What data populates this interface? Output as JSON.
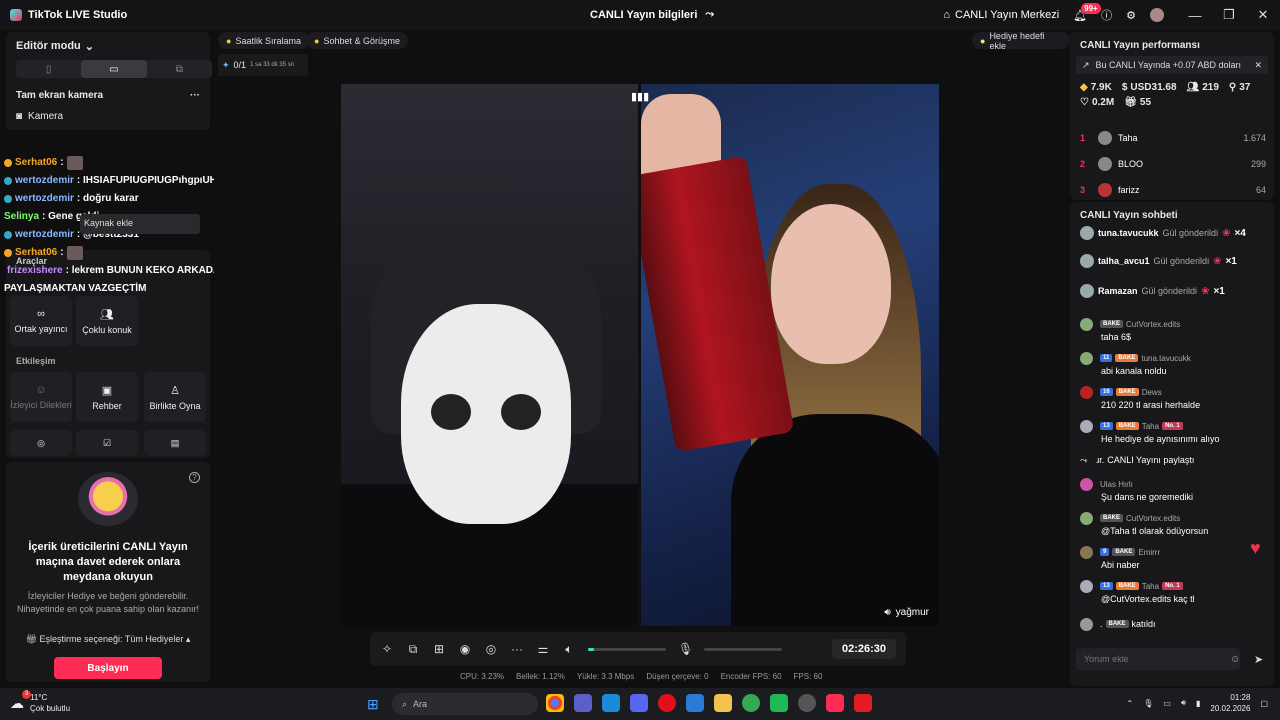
{
  "app": {
    "title": "TikTok LIVE Studio",
    "center_title": "CANLI Yayın bilgileri",
    "center_icon": "share-icon"
  },
  "header": {
    "live_center": "CANLI Yayın Merkezi",
    "notif_badge": "99+"
  },
  "left": {
    "editor_mode": "Editör modu",
    "source_title": "Tam ekran kamera",
    "camera_label": "Kamera",
    "tooltip": "Kaynak ekle",
    "tools_label": "Araçlar",
    "tools": [
      {
        "label": "Ortak yayıncı",
        "icon": "link-icon"
      },
      {
        "label": "Çoklu konuk",
        "icon": "users-icon"
      }
    ],
    "interaction_label": "Etkileşim",
    "interaction": [
      {
        "label": "İzleyici Dilekleri",
        "icon": "wishes-icon"
      },
      {
        "label": "Rehber",
        "icon": "guide-icon"
      },
      {
        "label": "Birlikte Oyna",
        "icon": "play-together-icon"
      }
    ],
    "promo": {
      "title": "İçerik üreticilerini CANLI Yayın maçına davet ederek onlara meydana okuyun",
      "desc": "İzleyiciler Hediye ve beğeni gönderebilir. Nihayetinde en çok puana sahip olan kazanır!",
      "match_option": "Eşleştirme seçeneği: Tüm Hediyeler",
      "button": "Başlayın"
    }
  },
  "overlay_chat": [
    {
      "user": "Serhat06",
      "text": "",
      "color": "gold"
    },
    {
      "user": "wertozdemir",
      "text": ": IHSIAFUPIUGPIUGPıhgpıUH",
      "color": "blue"
    },
    {
      "user": "wertozdemir",
      "text": ": doğru karar",
      "color": "blue"
    },
    {
      "user": "Selinya",
      "text": ": Gene geldi",
      "color": "green"
    },
    {
      "user": "wertozdemir",
      "text": ": @bestt2331",
      "color": "blue"
    },
    {
      "user": "Serhat06",
      "text": "",
      "color": "gold"
    },
    {
      "user": "frizexishere",
      "text": ": lekrem BUNUN KEKO ARKADAŞLARI MAFYA SEVGİLİLERİ ÖLDÜRÜR BENİ",
      "color": "purple"
    },
    {
      "user": "",
      "text": "PAYLAŞMAKTAN VAZGEÇTİM",
      "color": "white"
    }
  ],
  "center": {
    "chip_hourly": "Saatlik Sıralama",
    "chip_chat": "Sohbet & Görüşme",
    "chip_gift_goal": "Hediye hedefi ekle",
    "goal_progress": "0/1",
    "goal_time": "1 sa 33 dk 35 sn",
    "video_name": "yağmur",
    "timer": "02:26:30",
    "mic_level": 0.08,
    "stats": [
      "CPU:  3.23%",
      "Bellek:  1.12%",
      "Yükle:  3.3 Mbps",
      "Düşen çerçeve:  0",
      "Encoder FPS:  60",
      "FPS:  60"
    ]
  },
  "right": {
    "perf_title": "CANLI Yayın performansı",
    "perf_banner": "Bu CANLI Yayında +0.07 ABD doları",
    "stats": [
      {
        "icon": "diamond-icon",
        "value": "7.9K"
      },
      {
        "icon": "dollar-icon",
        "value": "USD31.68"
      },
      {
        "icon": "viewers-icon",
        "value": "219"
      },
      {
        "icon": "follow-icon",
        "value": "37"
      },
      {
        "icon": "heart-icon",
        "value": "0.2M"
      },
      {
        "icon": "gift-icon",
        "value": "55"
      }
    ],
    "ranking": [
      {
        "no": "1",
        "name": "Taha",
        "value": "1.674"
      },
      {
        "no": "2",
        "name": "BLOO",
        "value": "299"
      },
      {
        "no": "3",
        "name": "farizz",
        "value": "64"
      }
    ],
    "chat_title": "CANLI Yayın sohbeti",
    "gifts": [
      {
        "name": "tuna.tavucukk",
        "text": "Gül gönderildi",
        "count": "×4"
      },
      {
        "name": "talha_avcu1",
        "text": "Gül gönderildi",
        "count": "×1"
      },
      {
        "name": "Ramazan",
        "text": "Gül gönderildi",
        "count": "×1"
      }
    ],
    "messages": [
      {
        "user": "CutVortex.edits",
        "lvl": "",
        "bake": "BAKE",
        "no1": "",
        "text": "taha 6$"
      },
      {
        "user": "tuna.tavucukk",
        "lvl": "11",
        "bake": "BAKE",
        "no1": "",
        "text": "abi kanala noldu"
      },
      {
        "user": "Dews",
        "lvl": "16",
        "bake": "BAKE",
        "no1": "",
        "text": "210 220 tl arasi herhalde"
      },
      {
        "user": "Taha",
        "lvl": "13",
        "bake": "BAKE",
        "no1": "No. 1",
        "text": "He hediye de aynısınımı alıyo"
      },
      {
        "user": "",
        "lvl": "",
        "bake": "",
        "no1": "",
        "text": "CANLI Yayını paylaştı",
        "prefix": "ɹr."
      },
      {
        "user": "Ulas Hırlı",
        "lvl": "",
        "bake": "",
        "no1": "",
        "text": "Şu dans ne goremediki"
      },
      {
        "user": "CutVortex.edits",
        "lvl": "",
        "bake": "BAKE",
        "no1": "",
        "text": "@Taha tl olarak ödüyorsun"
      },
      {
        "user": "Emirrr",
        "lvl": "9",
        "bake": "BAKE",
        "no1": "",
        "text": "Abi naber"
      },
      {
        "user": "Taha",
        "lvl": "13",
        "bake": "BAKE",
        "no1": "No. 1",
        "text": "@CutVortex.edits kaç tl"
      },
      {
        "user": "",
        "lvl": "",
        "bake": "BAKE",
        "no1": "",
        "text": "katıldı",
        "prefix": "."
      }
    ],
    "chat_placeholder": "Yorum ekle"
  },
  "taskbar": {
    "temp": "11°C",
    "weather": "Çok bulutlu",
    "weather_badge": "3",
    "search": "Ara",
    "time": "01:28",
    "date": "20.02.2026"
  },
  "colors": {
    "accent": "#fe2c55",
    "teal": "#2ee6b8",
    "panel": "#18181b"
  }
}
